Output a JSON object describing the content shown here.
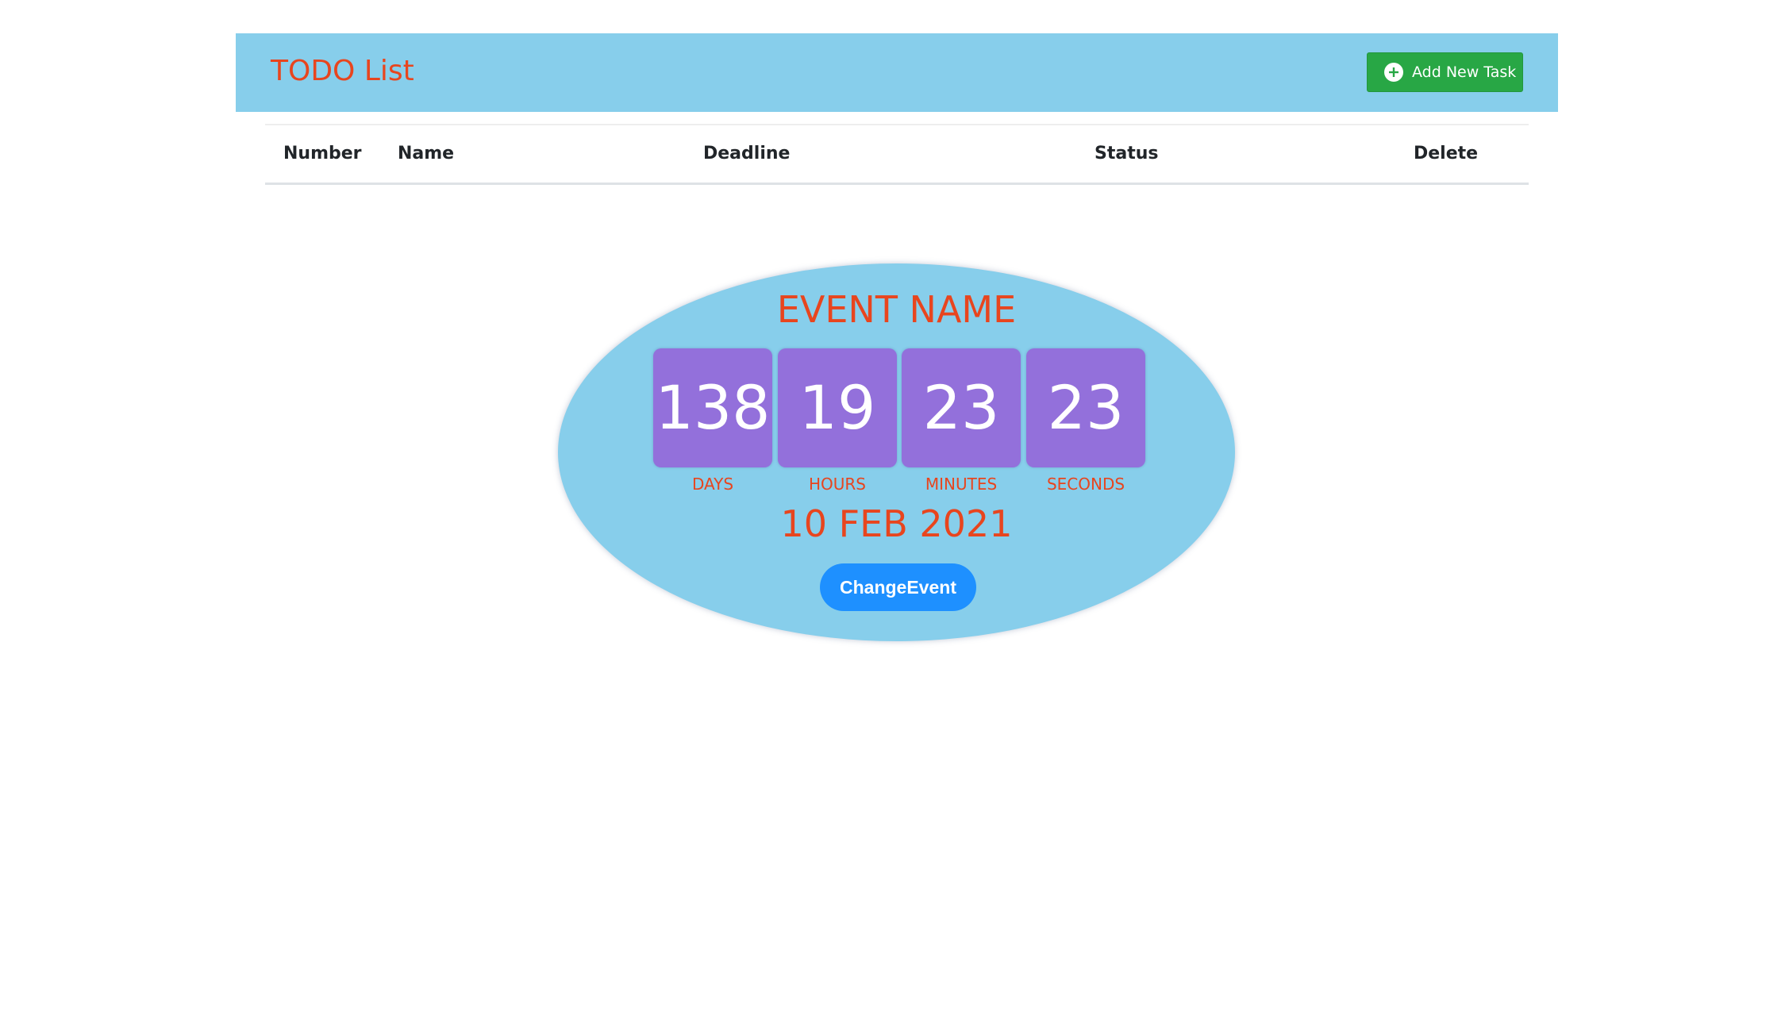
{
  "todo": {
    "title": "TODO List",
    "add_button_label": "Add New Task",
    "add_button_icon": "plus-circle-icon",
    "table": {
      "columns": [
        "Number",
        "Name",
        "Deadline",
        "Status",
        "Delete"
      ],
      "rows": []
    }
  },
  "event": {
    "name": "EVENT NAME",
    "countdown": {
      "days": "138",
      "hours": "19",
      "minutes": "23",
      "seconds": "23"
    },
    "labels": {
      "days": "DAYS",
      "hours": "HOURS",
      "minutes": "MINUTES",
      "seconds": "SECONDS"
    },
    "date": "10 FEB 2021",
    "change_button_label": "ChangeEvent"
  },
  "colors": {
    "header_bg": "#87ceeb",
    "title_text": "#e8451e",
    "add_button_bg": "#28a745",
    "countdown_box_bg": "#9370db",
    "change_button_bg": "#1e90ff"
  }
}
